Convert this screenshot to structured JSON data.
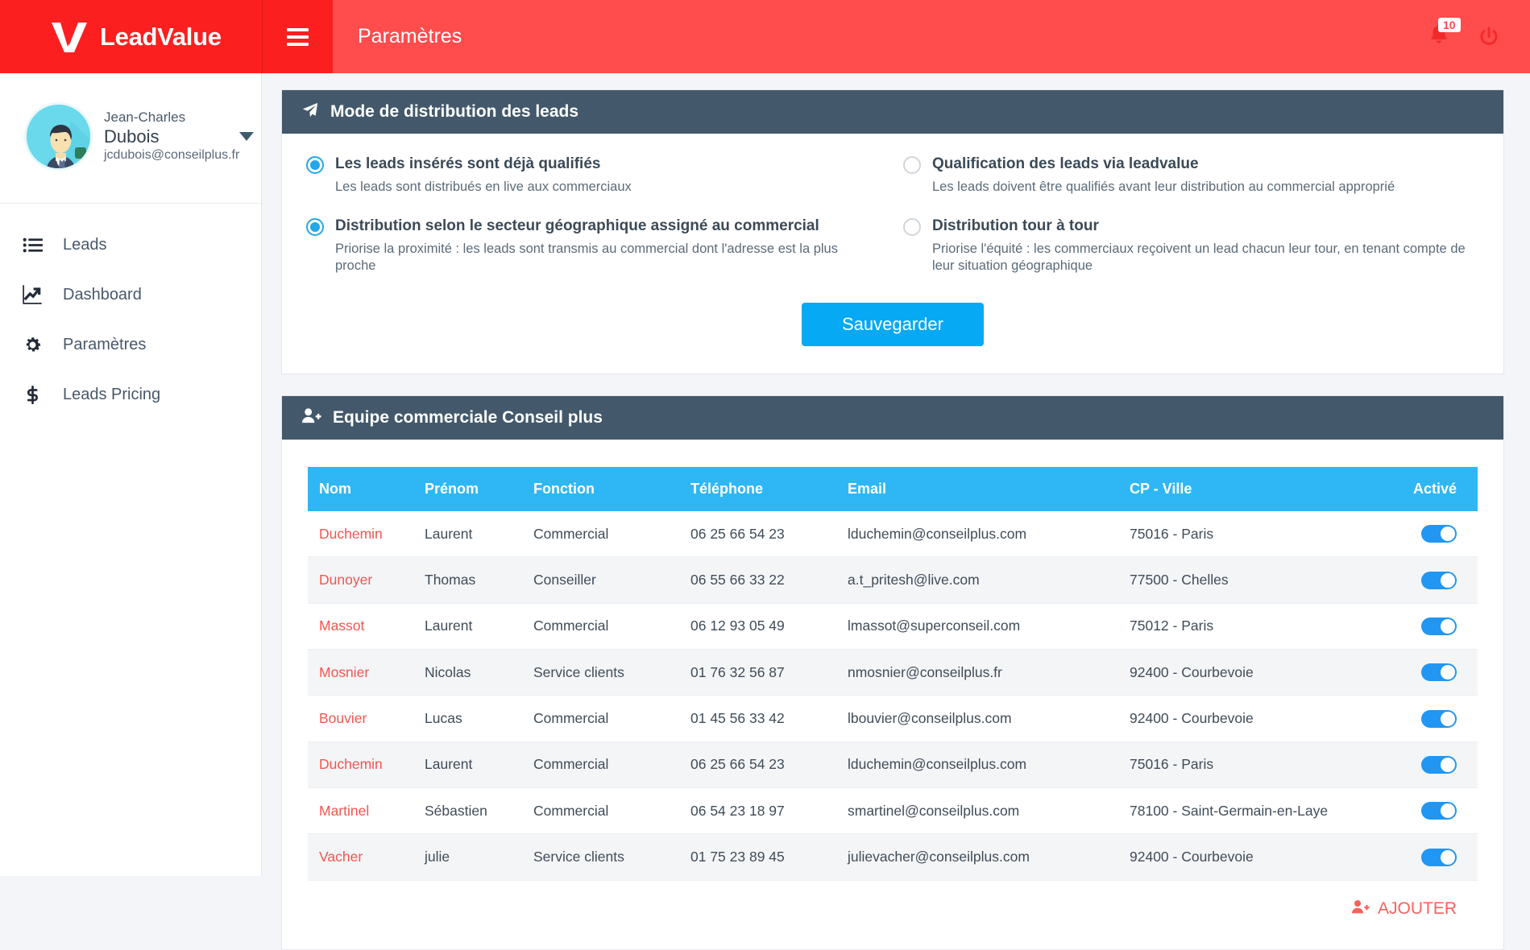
{
  "topbar": {
    "brand_name": "LeadValue",
    "logo_icon": "leadvalue-v-logo",
    "menu_icon": "hamburger-icon",
    "page_title": "Paramètres",
    "bell_icon": "bell-icon",
    "notification_count": "10",
    "power_icon": "power-icon",
    "bg_color": "#ff4c4c",
    "brand_bg_color": "#fc1f1f"
  },
  "sidebar": {
    "profile": {
      "first_name": "Jean-Charles",
      "last_name": "Dubois",
      "email": "jcdubois@conseilplus.fr",
      "avatar_icon": "avatar",
      "caret_icon": "caret-down-icon",
      "status": "online"
    },
    "items": [
      {
        "label": "Leads",
        "icon": "list-icon"
      },
      {
        "label": "Dashboard",
        "icon": "chart-line-icon"
      },
      {
        "label": "Paramètres",
        "icon": "gear-icon"
      },
      {
        "label": "Leads Pricing",
        "icon": "dollar-icon"
      }
    ]
  },
  "distribution_panel": {
    "icon": "paper-plane-icon",
    "title": "Mode de distribution des leads",
    "options": [
      {
        "title": "Les leads insérés sont déjà qualifiés",
        "desc": "Les leads sont distribués en live aux commerciaux",
        "selected": true
      },
      {
        "title": "Qualification des leads via leadvalue",
        "desc": "Les leads doivent être qualifiés avant leur distribution au commercial approprié",
        "selected": false
      },
      {
        "title": "Distribution selon le secteur géographique assigné au commercial",
        "desc": "Priorise la proximité : les leads sont transmis au commercial dont l'adresse est la plus proche",
        "selected": true
      },
      {
        "title": "Distribution tour à tour",
        "desc": "Priorise l'équité : les commerciaux reçoivent un lead chacun leur tour, en tenant compte de leur situation  géographique",
        "selected": false
      }
    ],
    "save_label": "Sauvegarder",
    "save_color": "#05a9f4"
  },
  "team_panel": {
    "icon": "user-plus-icon",
    "title": "Equipe commerciale Conseil plus",
    "header_color": "#43596b",
    "table_header_color": "#2eb7f4",
    "columns": [
      "Nom",
      "Prénom",
      "Fonction",
      "Téléphone",
      "Email",
      "CP - Ville",
      "Activé"
    ],
    "rows": [
      {
        "nom": "Duchemin",
        "prenom": "Laurent",
        "fonction": "Commercial",
        "telephone": "06 25 66 54 23",
        "email": "lduchemin@conseilplus.com",
        "cp_ville": "75016 - Paris",
        "active": true
      },
      {
        "nom": "Dunoyer",
        "prenom": "Thomas",
        "fonction": "Conseiller",
        "telephone": "06 55 66 33 22",
        "email": "a.t_pritesh@live.com",
        "cp_ville": "77500 - Chelles",
        "active": true
      },
      {
        "nom": "Massot",
        "prenom": "Laurent",
        "fonction": "Commercial",
        "telephone": "06 12 93 05 49",
        "email": "lmassot@superconseil.com",
        "cp_ville": "75012 - Paris",
        "active": true
      },
      {
        "nom": "Mosnier",
        "prenom": "Nicolas",
        "fonction": "Service clients",
        "telephone": "01 76 32 56 87",
        "email": "nmosnier@conseilplus.fr",
        "cp_ville": "92400 - Courbevoie",
        "active": true
      },
      {
        "nom": "Bouvier",
        "prenom": "Lucas",
        "fonction": "Commercial",
        "telephone": "01 45 56 33 42",
        "email": "lbouvier@conseilplus.com",
        "cp_ville": "92400 - Courbevoie",
        "active": true
      },
      {
        "nom": "Duchemin",
        "prenom": "Laurent",
        "fonction": "Commercial",
        "telephone": "06 25 66 54 23",
        "email": "lduchemin@conseilplus.com",
        "cp_ville": "75016 - Paris",
        "active": true
      },
      {
        "nom": "Martinel",
        "prenom": "Sébastien",
        "fonction": "Commercial",
        "telephone": "06 54 23 18 97",
        "email": "smartinel@conseilplus.com",
        "cp_ville": "78100 - Saint-Germain-en-Laye",
        "active": true
      },
      {
        "nom": "Vacher",
        "prenom": "julie",
        "fonction": "Service clients",
        "telephone": "01 75 23 89 45",
        "email": "julievacher@conseilplus.com",
        "cp_ville": "92400 - Courbevoie",
        "active": true
      }
    ],
    "add_label": "AJOUTER",
    "add_icon": "user-plus-icon",
    "add_color": "#f9615c"
  }
}
